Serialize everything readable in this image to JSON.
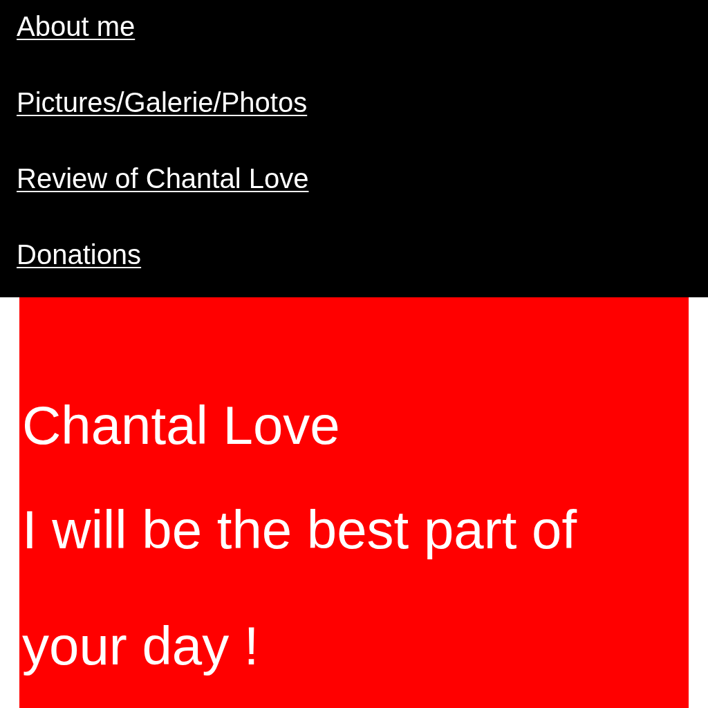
{
  "nav": {
    "links": [
      "About me",
      "Pictures/Galerie/Photos",
      "Review of Chantal Love",
      "Donations"
    ]
  },
  "hero": {
    "title": "Chantal Love",
    "tagline": "I will be the best part of your day !"
  }
}
